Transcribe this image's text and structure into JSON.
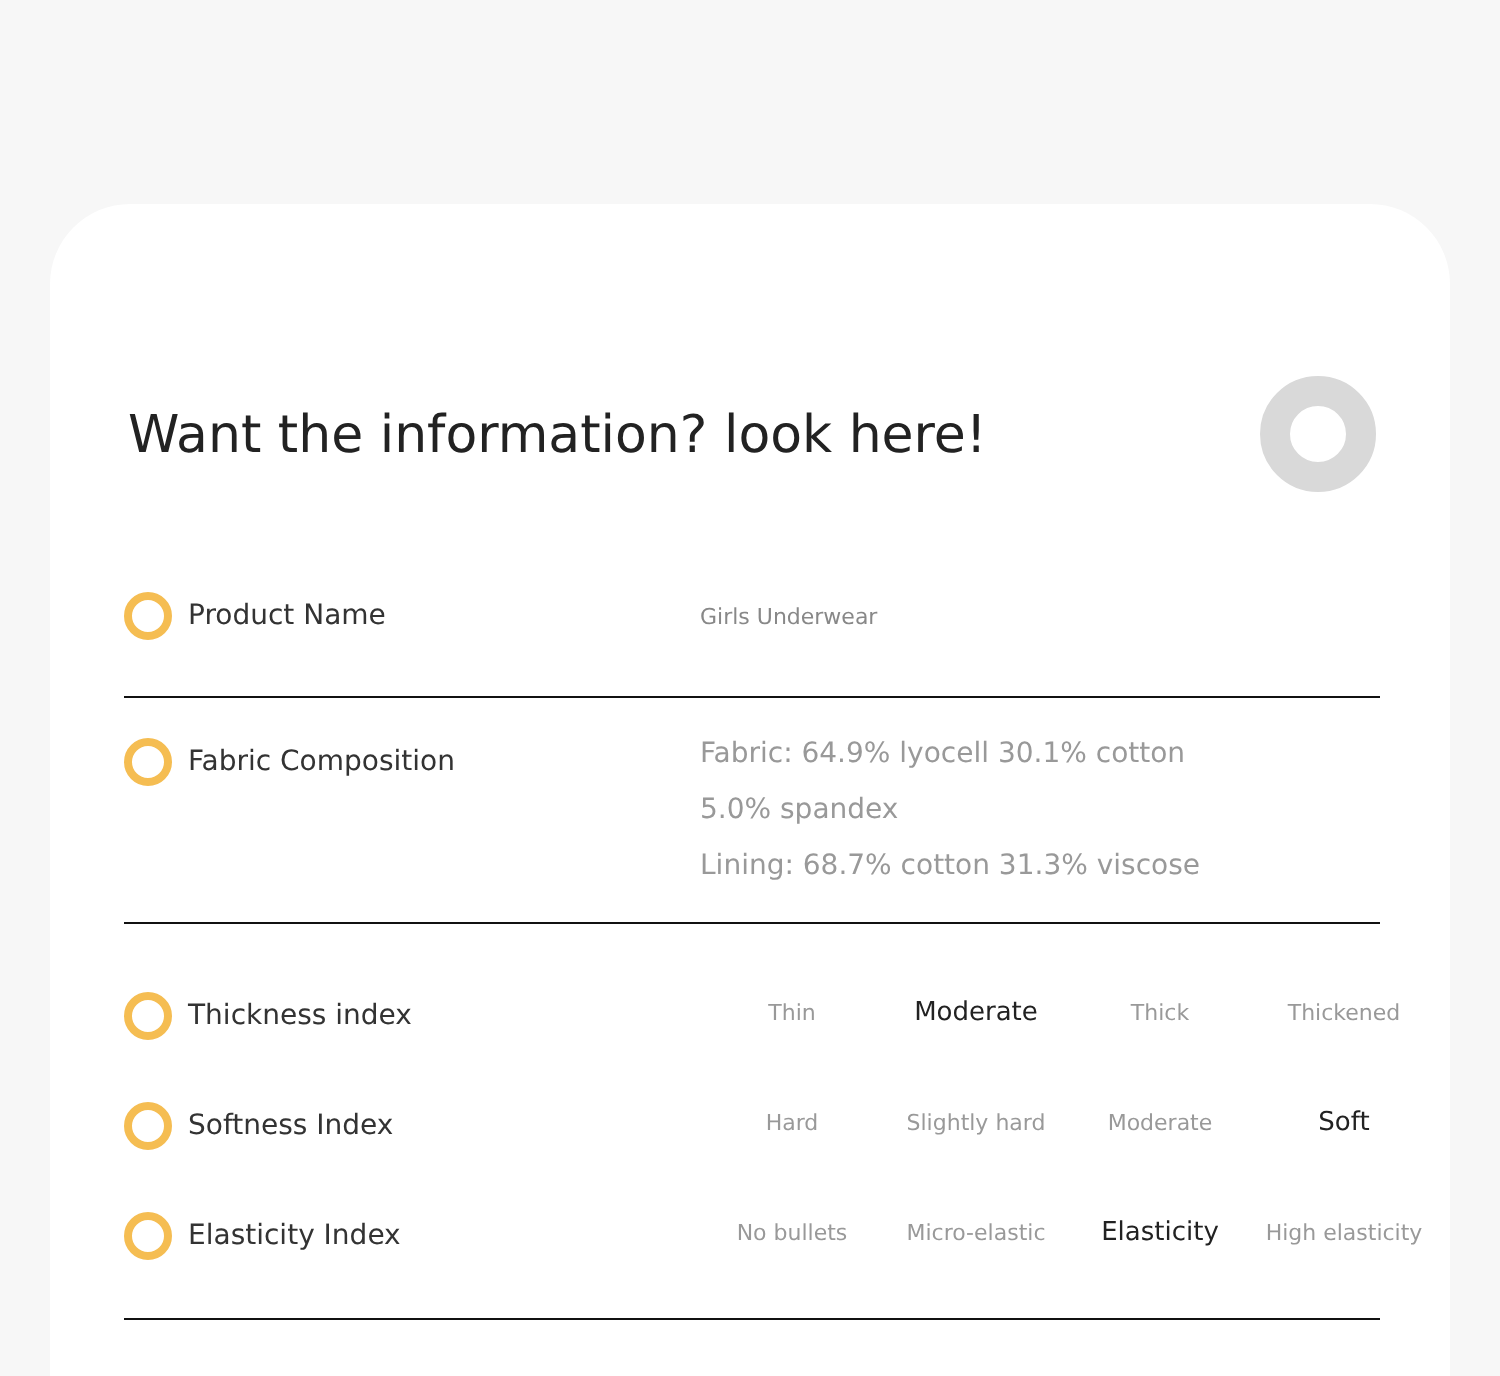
{
  "title": "Want the information? look here!",
  "fields": [
    {
      "label": "Product Name",
      "values": [
        "Girls Underwear"
      ]
    },
    {
      "label": "Fabric Composition",
      "values": [
        "Fabric: 64.9% lyocell 30.1% cotton",
        "5.0% spandex",
        "Lining: 68.7% cotton 31.3% viscose"
      ]
    }
  ],
  "indices": [
    {
      "label": "Thickness index",
      "options": [
        {
          "text": "Thin",
          "selected": false
        },
        {
          "text": "Moderate",
          "selected": true
        },
        {
          "text": "Thick",
          "selected": false
        },
        {
          "text": "Thickened",
          "selected": false
        }
      ]
    },
    {
      "label": "Softness Index",
      "options": [
        {
          "text": "Hard",
          "selected": false
        },
        {
          "text": "Slightly hard",
          "selected": false
        },
        {
          "text": "Moderate",
          "selected": false
        },
        {
          "text": "Soft",
          "selected": true
        }
      ]
    },
    {
      "label": "Elasticity Index",
      "options": [
        {
          "text": "No bullets",
          "selected": false
        },
        {
          "text": "Micro-elastic",
          "selected": false
        },
        {
          "text": "Elasticity",
          "selected": true
        },
        {
          "text": "High elasticity",
          "selected": false
        }
      ]
    }
  ]
}
